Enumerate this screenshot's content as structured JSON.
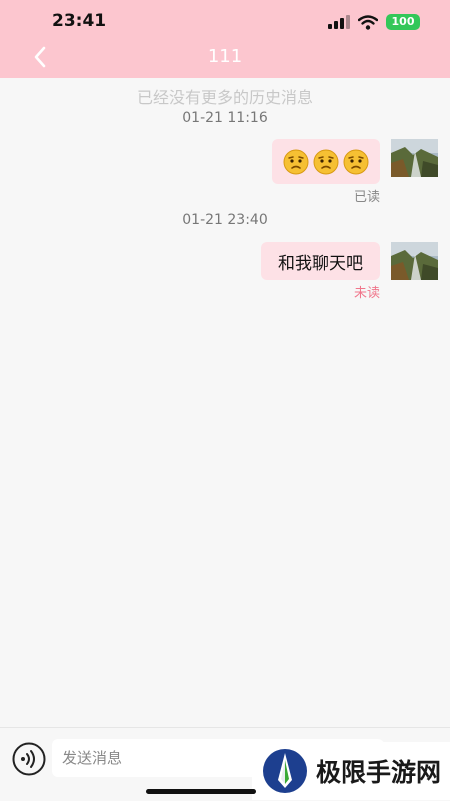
{
  "status_bar": {
    "time": "23:41",
    "battery": "100"
  },
  "header": {
    "title": "111",
    "back_icon": "chevron-left-icon"
  },
  "history_note": "已经没有更多的历史消息",
  "messages": [
    {
      "timestamp": "01-21 11:16",
      "type": "emoji",
      "emoji": [
        "confused-face",
        "confused-face",
        "confused-face"
      ],
      "receipt": "已读",
      "receipt_color": "#888888"
    },
    {
      "timestamp": "01-21 23:40",
      "type": "text",
      "text": "和我聊天吧",
      "receipt": "未读",
      "receipt_color": "#f0768b"
    }
  ],
  "input": {
    "placeholder": "发送消息",
    "value": ""
  },
  "watermark": {
    "text": "极限手游网"
  },
  "colors": {
    "header_bg": "#fcc6cf",
    "bubble_bg": "#fde1e6",
    "page_bg": "#f7f7f7",
    "unread": "#f0768b",
    "battery": "#33c759"
  }
}
